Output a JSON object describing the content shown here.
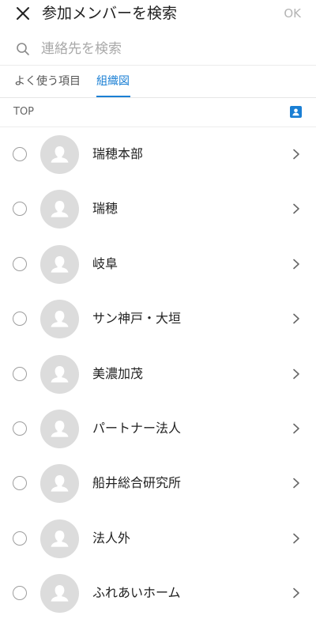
{
  "header": {
    "title": "参加メンバーを検索",
    "ok_label": "OK"
  },
  "search": {
    "placeholder": "連絡先を検索"
  },
  "tabs": [
    {
      "label": "よく使う項目",
      "active": false
    },
    {
      "label": "組織図",
      "active": true
    }
  ],
  "section": {
    "label": "TOP",
    "icon": "contact-card-icon"
  },
  "items": [
    {
      "name": "瑞穂本部"
    },
    {
      "name": "瑞穂"
    },
    {
      "name": "岐阜"
    },
    {
      "name": "サン神戸・大垣"
    },
    {
      "name": "美濃加茂"
    },
    {
      "name": "パートナー法人"
    },
    {
      "name": "船井総合研究所"
    },
    {
      "name": "法人外"
    },
    {
      "name": "ふれあいホーム"
    }
  ],
  "colors": {
    "accent": "#1a7fd4",
    "avatar_bg": "#dcdcdc",
    "muted": "#b4b4b4"
  }
}
